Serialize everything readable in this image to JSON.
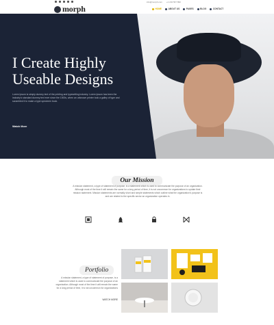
{
  "header": {
    "logo_text": "morph",
    "contact": [
      "info@morph.com",
      "+1 234 567 890"
    ],
    "nav": [
      {
        "label": "Home",
        "active": true
      },
      {
        "label": "About Us",
        "active": false
      },
      {
        "label": "Pages",
        "active": false
      },
      {
        "label": "Blog",
        "active": false
      },
      {
        "label": "Contact",
        "active": false
      }
    ],
    "social_icons": [
      "facebook-icon",
      "twitter-icon",
      "linkedin-icon",
      "pinterest-icon",
      "instagram-icon"
    ]
  },
  "hero": {
    "title_line1": "I Create Highly",
    "title_line2": "Useable Designs",
    "text": "Lorem Ipsum is simply dummy text of the printing and typesetting industry. Lorem Ipsum has been the industry's standard dummy text ever since the 1500s, when an unknown printer took a galley of type and scrambled it to make a type specimen book.",
    "button": "Watch More"
  },
  "mission": {
    "title": "Our Mission",
    "text": "A mission statement, a type of statement of purpose, is a statement which is used to communicate the purpose of an organization. Although most of the time it will remain the same for a long period of time, it is not uncommon for organizations to update their mission statement. Mission statements are normally short and simple statements which outline what the organization's purpose is and are related to the specific sector an organization operates in.",
    "icons": [
      "frame-icon",
      "flame-icon",
      "lock-icon",
      "monogram-icon"
    ]
  },
  "portfolio": {
    "title": "Portfolio",
    "text": "A mission statement, a type of statement of purpose, is a statement which is used to communicate the purpose of an organization. Although most of the time it will remain the same for a long period of time, it is not uncommon for organizations",
    "link": "WATCH MORE"
  },
  "colors": {
    "hero_panel": "#1b2336",
    "accent": "#e0b400"
  }
}
